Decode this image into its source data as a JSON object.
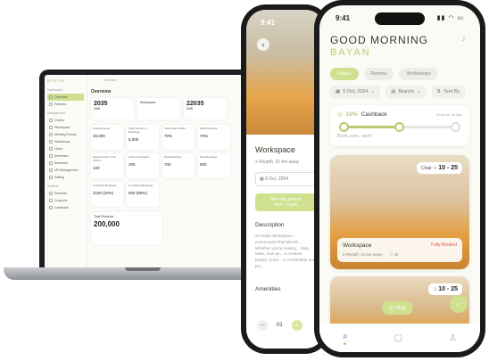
{
  "laptop": {
    "logo": "BAYAN",
    "crumb": "Overview",
    "title": "Overview",
    "sections": [
      "Dashboard",
      "Management",
      "General"
    ],
    "items": [
      "Overview",
      "Partners",
      "Orders",
      "Workspace",
      "Meeting Rooms",
      "Workshops",
      "Users",
      "Amenities",
      "Branches",
      "HR Management",
      "Setting",
      "Rewards",
      "Coupons",
      "Cashback"
    ],
    "tiles": [
      {
        "value": "2035",
        "unit": "SAR",
        "label": ""
      },
      {
        "value": "",
        "unit": "",
        "label": "Workspace"
      },
      {
        "value": "22035",
        "unit": "SAR",
        "label": ""
      },
      {
        "value": "",
        "unit": "",
        "label": "Meeting Room"
      }
    ],
    "cells": [
      {
        "label": "Total Revenue",
        "value": "30,000"
      },
      {
        "label": "Total number of Bookings",
        "value": "5,000"
      },
      {
        "label": "Subscription Rate",
        "value": "70%"
      },
      {
        "label": "Bookings Rate",
        "value": "70%"
      },
      {
        "label": "Expected Due Time Orders",
        "value": "100"
      },
      {
        "label": "Active workspace",
        "value": "200"
      },
      {
        "label": "Seat Bookings",
        "value": "700"
      },
      {
        "label": "Total Bookings",
        "value": "500"
      },
      {
        "label": "Cancelled Bookings",
        "value": "2150 (20%)"
      },
      {
        "label": "Completed Bookings",
        "value": "500 (80%)"
      }
    ],
    "revenue_label": "Total Revenue",
    "revenue_value": "200,000"
  },
  "phone_back": {
    "time": "9:41",
    "title": "Workspace",
    "location": "Riyadh, 31 km away",
    "date": "5 Oct, 2024",
    "period_label": "Morning period",
    "period_time": "6am - 12pm",
    "description_heading": "Description",
    "description": "At Ashjar Workspace... environment that blends... Whether you're looking... daily tasks, host an... a creative project, you'll... a comfortable and pro...",
    "amenities_heading": "Amenities",
    "qty_value": "01"
  },
  "phone_front": {
    "time": "9:41",
    "greeting": "GOOD MORNING",
    "name": "BAYAN",
    "tabs": [
      "Chairs",
      "Rooms",
      "Workshops"
    ],
    "filters": [
      "5 Oct, 2024",
      "Branch",
      "Sort By"
    ],
    "cashback": {
      "percent": "10%",
      "label": "Cashback",
      "ends": "Ends on 15 Nov",
      "subtitle": "Book, earn, save!",
      "progress": 0.5
    },
    "card": {
      "chair_label": "Chair",
      "capacity": "10 - 25",
      "title": "Workspace",
      "status": "Fully Booked",
      "location": "Riyadh, 31 km away",
      "people": "2k"
    },
    "card2_capacity": "10 - 25",
    "map_label": "Map",
    "colors": {
      "accent": "#cfe08f",
      "brand": "#b7cd6d",
      "booked": "#e05555"
    }
  }
}
